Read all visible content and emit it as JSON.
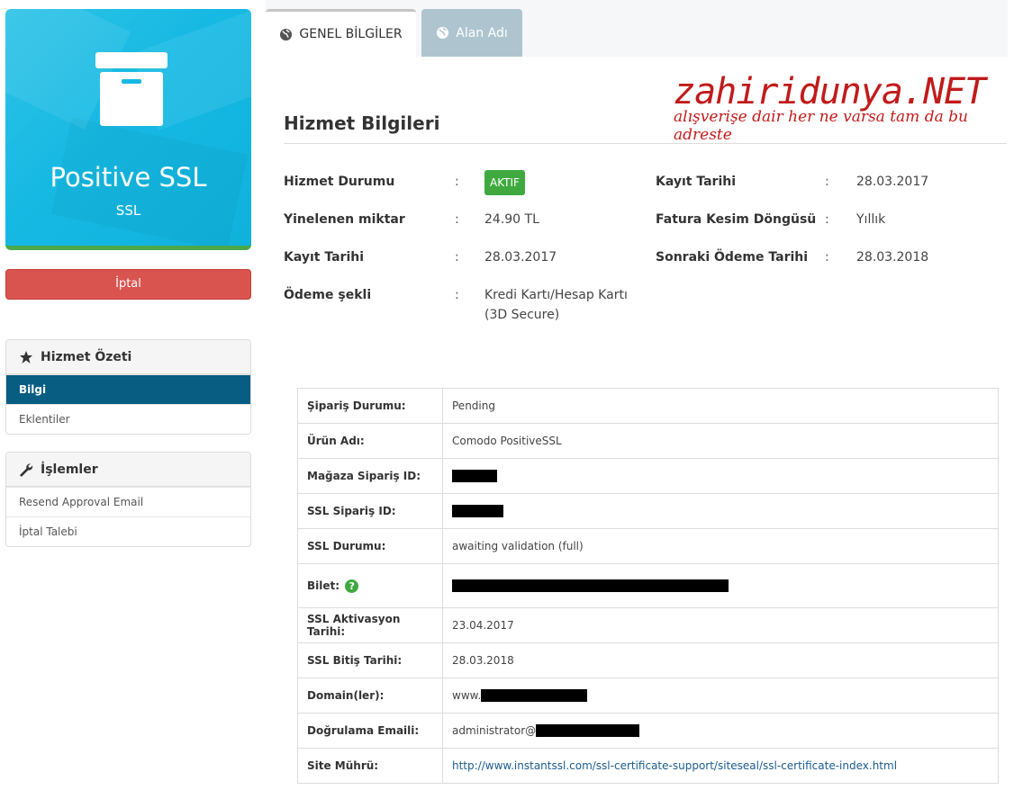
{
  "product": {
    "title": "Positive SSL",
    "subtitle": "SSL"
  },
  "actions": {
    "cancel_label": "İptal"
  },
  "summary_panel": {
    "title": "Hizmet Özeti",
    "items": [
      "Bilgi",
      "Eklentiler"
    ],
    "active_index": 0
  },
  "operations_panel": {
    "title": "İşlemler",
    "items": [
      "Resend Approval Email",
      "İptal Talebi"
    ]
  },
  "tabs": [
    {
      "label": "GENEL BİLGİLER",
      "active": true
    },
    {
      "label": "Alan Adı",
      "active": false
    }
  ],
  "watermark": {
    "main": "zahiridunya.NET",
    "sub": "alışverişe dair her ne varsa tam da bu adreste"
  },
  "section_title": "Hizmet Bilgileri",
  "info_left": [
    {
      "label": "Hizmet Durumu",
      "value": "AKTIF",
      "badge": true
    },
    {
      "label": "Yinelenen miktar",
      "value": "24.90 TL"
    },
    {
      "label": "Kayıt Tarihi",
      "value": "28.03.2017"
    },
    {
      "label": "Ödeme şekli",
      "value": "Kredi Kartı/Hesap Kartı",
      "value2": "(3D Secure)"
    }
  ],
  "info_right": [
    {
      "label": "Kayıt Tarihi",
      "value": "28.03.2017"
    },
    {
      "label": "Fatura Kesim Döngüsü",
      "value": "Yıllık"
    },
    {
      "label": "Sonraki Ödeme Tarihi",
      "value": "28.03.2018"
    }
  ],
  "separator": ":",
  "ssl_table": [
    {
      "key": "Şipariş Durumu:",
      "value": "Pending"
    },
    {
      "key": "Ürün Adı:",
      "value": "Comodo PositiveSSL"
    },
    {
      "key": "Mağaza Sipariş ID:",
      "value": ""
    },
    {
      "key": "SSL Sipariş ID:",
      "value": ""
    },
    {
      "key": "SSL Durumu:",
      "value": "awaiting validation (full)"
    },
    {
      "key": "Bilet:",
      "value": ""
    },
    {
      "key": "SSL Aktivasyon Tarihi:",
      "value": "23.04.2017"
    },
    {
      "key": "SSL Bitiş Tarihi:",
      "value": "28.03.2018"
    },
    {
      "key": "Domain(ler):",
      "value": "www."
    },
    {
      "key": "Doğrulama Emaili:",
      "value": "administrator@"
    },
    {
      "key": "Site Mührü:",
      "value": "http://www.instantssl.com/ssl-certificate-support/siteseal/ssl-certificate-index.html"
    }
  ],
  "icons": {
    "product": "archive-box-icon",
    "summary": "star-icon",
    "operations": "wrench-icon",
    "tab": "globe-icon",
    "help": "question-circle-icon"
  },
  "colors": {
    "card_blue": "#16b9e3",
    "cancel_red": "#d9534f",
    "active_blue": "#075d82",
    "success_green": "#3fa93f"
  }
}
